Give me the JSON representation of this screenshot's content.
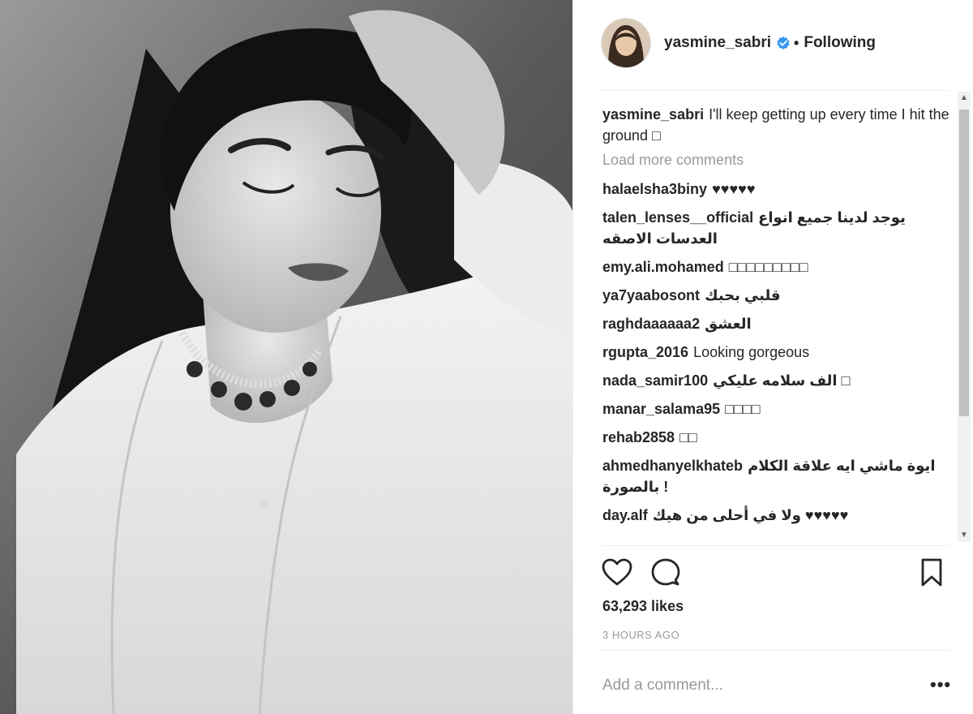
{
  "header": {
    "username": "yasmine_sabri",
    "status": "Following",
    "separator": "•"
  },
  "caption": {
    "user": "yasmine_sabri",
    "text": "I'll keep getting up every time I hit the ground □"
  },
  "load_more": "Load more comments",
  "comments": [
    {
      "user": "halaelsha3biny",
      "text": "♥♥♥♥♥",
      "rtl": false
    },
    {
      "user": "talen_lenses__official",
      "text": "يوجد لدينا جميع انواع العدسات الاصقه",
      "rtl": true
    },
    {
      "user": "emy.ali.mohamed",
      "text": "□□□□□□□□□",
      "rtl": false
    },
    {
      "user": "ya7yaabosont",
      "text": "قلبي بحبك",
      "rtl": true
    },
    {
      "user": "raghdaaaaaa2",
      "text": "العشق",
      "rtl": true
    },
    {
      "user": "rgupta_2016",
      "text": "Looking gorgeous",
      "rtl": false
    },
    {
      "user": "nada_samir100",
      "text": "الف سلامه عليكي □",
      "rtl": true
    },
    {
      "user": "manar_salama95",
      "text": "□□□□",
      "rtl": false
    },
    {
      "user": "rehab2858",
      "text": "□□",
      "rtl": false
    },
    {
      "user": "ahmedhanyelkhateb",
      "text": "ايوة ماشي ايه علاقة الكلام بالصورة !",
      "rtl": true
    },
    {
      "user": "day.alf",
      "text": "ولا في أحلى من هيك ♥♥♥♥♥",
      "rtl": true
    }
  ],
  "likes": "63,293 likes",
  "time": "3 HOURS AGO",
  "add_comment": {
    "placeholder": "Add a comment..."
  },
  "more_label": "•••",
  "icons": {
    "like": "heart-icon",
    "comment": "speech-bubble-icon",
    "save": "bookmark-icon",
    "verified": "verified-badge-icon"
  },
  "colors": {
    "verified": "#3897f0",
    "muted": "#999999",
    "text": "#262626"
  }
}
